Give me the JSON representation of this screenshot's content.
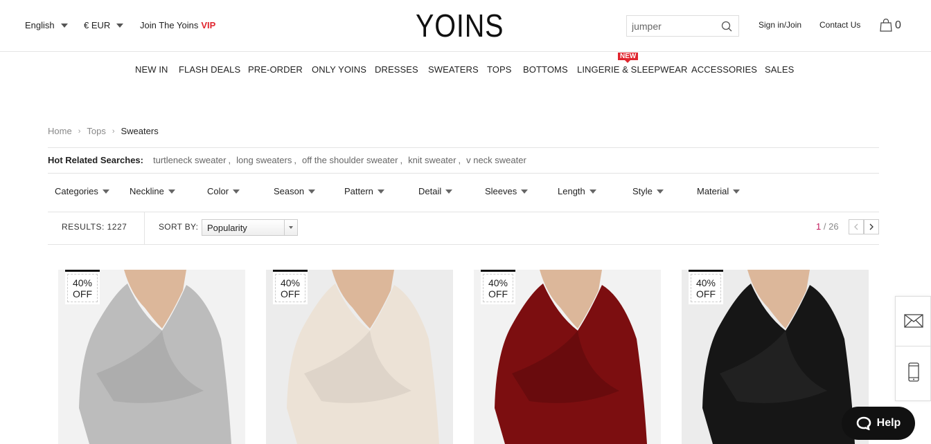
{
  "header": {
    "language": "English",
    "currency": "€ EUR",
    "vip_prefix": "Join The Yoins",
    "vip_label": "VIP",
    "logo": "YOINS",
    "search_value": "jumper",
    "signin": "Sign in/Join",
    "contact": "Contact Us",
    "cart_count": "0",
    "brand_red": "#e0262f"
  },
  "nav": {
    "items": [
      "NEW IN",
      "FLASH DEALS",
      "PRE-ORDER",
      "ONLY YOINS",
      "DRESSES",
      "SWEATERS",
      "TOPS",
      "BOTTOMS",
      "LINGERIE & SLEEPWEAR",
      "ACCESSORIES",
      "SALES"
    ],
    "new_badge": "NEW"
  },
  "breadcrumb": [
    "Home",
    "Tops",
    "Sweaters"
  ],
  "hot_searches": {
    "label": "Hot Related Searches:",
    "items": [
      "turtleneck sweater",
      "long sweaters",
      "off the shoulder sweater",
      "knit sweater",
      "v neck sweater"
    ]
  },
  "filters": [
    "Categories",
    "Neckline",
    "Color",
    "Season",
    "Pattern",
    "Detail",
    "Sleeves",
    "Length",
    "Style",
    "Material"
  ],
  "toolbar": {
    "results": "RESULTS: 1227",
    "sort_label": "SORT BY:",
    "sort_value": "Popularity",
    "page_current": "1",
    "page_total": "/ 26"
  },
  "products": [
    {
      "discount_pct": "40%",
      "discount_off": "OFF",
      "color": "#bcbcbc",
      "bg": "#f2f2f2"
    },
    {
      "discount_pct": "40%",
      "discount_off": "OFF",
      "color": "#ece2d6",
      "bg": "#ececec"
    },
    {
      "discount_pct": "40%",
      "discount_off": "OFF",
      "color": "#7c0e10",
      "bg": "#f2f2f2"
    },
    {
      "discount_pct": "40%",
      "discount_off": "OFF",
      "color": "#161616",
      "bg": "#ececec"
    }
  ],
  "help": "Help"
}
